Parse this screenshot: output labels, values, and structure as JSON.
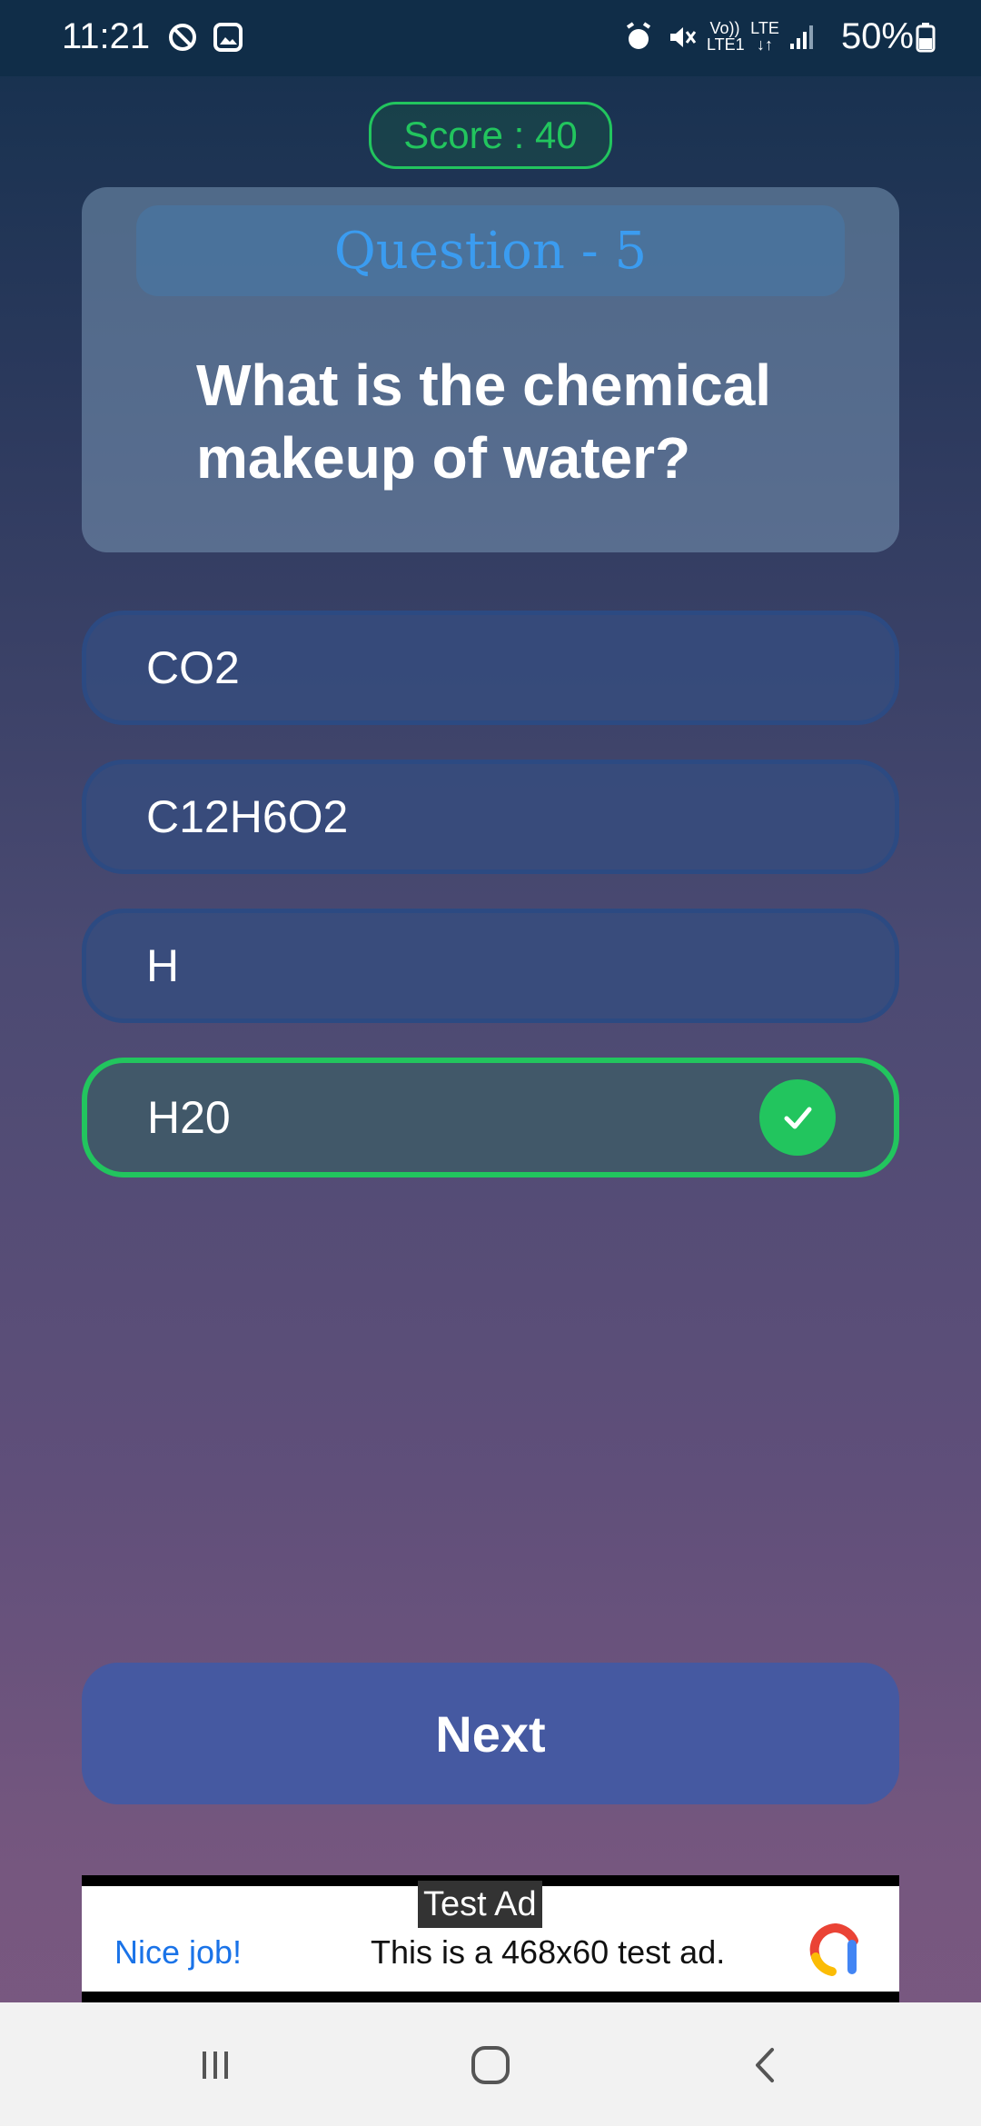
{
  "status_bar": {
    "time": "11:21",
    "battery": "50%",
    "volte": "Vo))",
    "lte1": "LTE1",
    "lte": "LTE",
    "arrows": "↓↑"
  },
  "score": {
    "label": "Score : 40"
  },
  "question": {
    "header": "Question - 5",
    "text": "What is the chemical makeup of water?"
  },
  "options": [
    {
      "label": "CO2",
      "state": "default"
    },
    {
      "label": "C12H6O2",
      "state": "default"
    },
    {
      "label": "H",
      "state": "default"
    },
    {
      "label": "H20",
      "state": "correct"
    }
  ],
  "next_button": {
    "label": "Next"
  },
  "ad": {
    "tag": "Test Ad",
    "headline": "Nice job!",
    "body": "This is a 468x60 test ad."
  },
  "colors": {
    "accent_green": "#22c55e",
    "question_blue": "#3b9cf0",
    "button_blue": "#4559a1"
  },
  "nav": {
    "icons": [
      "recent-apps-icon",
      "home-icon",
      "back-icon"
    ]
  }
}
